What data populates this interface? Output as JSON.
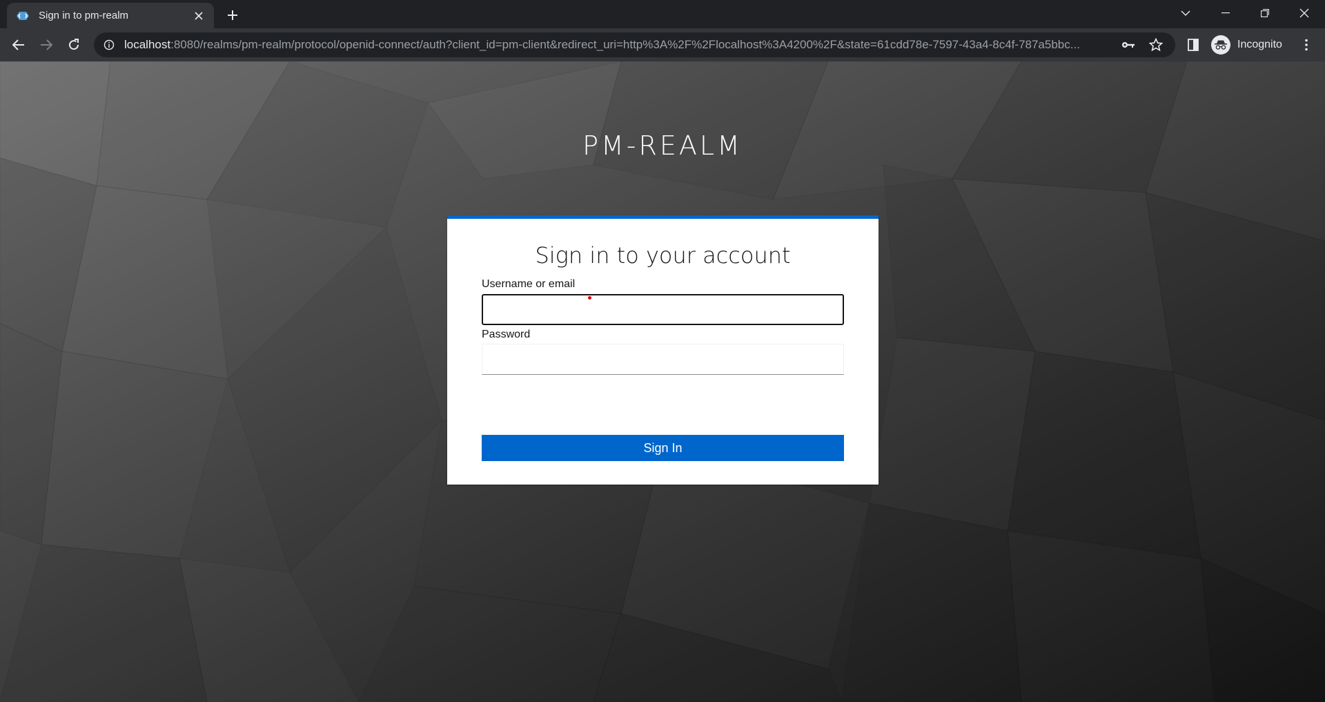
{
  "browser": {
    "tab_title": "Sign in to pm-realm",
    "url_host": "localhost",
    "url_rest": ":8080/realms/pm-realm/protocol/openid-connect/auth?client_id=pm-client&redirect_uri=http%3A%2F%2Flocalhost%3A4200%2F&state=61cdd78e-7597-43a4-8c4f-787a5bbc...",
    "profile_label": "Incognito",
    "icons": [
      "back-icon",
      "forward-icon",
      "reload-icon",
      "site-info-icon",
      "key-icon",
      "star-icon",
      "side-panel-icon",
      "incognito-icon",
      "menu-icon"
    ]
  },
  "page": {
    "realm_name": "PM-REALM",
    "heading": "Sign in to your account",
    "username_label": "Username or email",
    "username_value": "",
    "password_label": "Password",
    "password_value": "",
    "submit_label": "Sign In"
  },
  "colors": {
    "accent": "#0066cc",
    "chrome_dark": "#202124",
    "chrome_toolbar": "#35363a"
  }
}
